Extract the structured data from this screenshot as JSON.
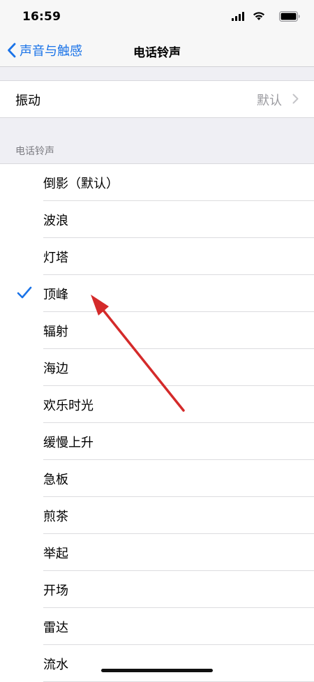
{
  "status": {
    "time": "16:59"
  },
  "nav": {
    "back_label": "声音与触感",
    "title": "电话铃声"
  },
  "vibration": {
    "label": "振动",
    "value": "默认"
  },
  "section_header": "电话铃声",
  "ringtones": [
    {
      "label": "倒影（默认）",
      "selected": false
    },
    {
      "label": "波浪",
      "selected": false
    },
    {
      "label": "灯塔",
      "selected": false
    },
    {
      "label": "顶峰",
      "selected": true
    },
    {
      "label": "辐射",
      "selected": false
    },
    {
      "label": "海边",
      "selected": false
    },
    {
      "label": "欢乐时光",
      "selected": false
    },
    {
      "label": "缓慢上升",
      "selected": false
    },
    {
      "label": "急板",
      "selected": false
    },
    {
      "label": "煎茶",
      "selected": false
    },
    {
      "label": "举起",
      "selected": false
    },
    {
      "label": "开场",
      "selected": false
    },
    {
      "label": "雷达",
      "selected": false
    },
    {
      "label": "流水",
      "selected": false
    }
  ],
  "colors": {
    "accent": "#1a73e8",
    "annotation_arrow": "#d42a2a"
  },
  "icons": {
    "check": "checkmark-icon",
    "back": "chevron-left-icon",
    "disclosure": "chevron-right-icon"
  }
}
